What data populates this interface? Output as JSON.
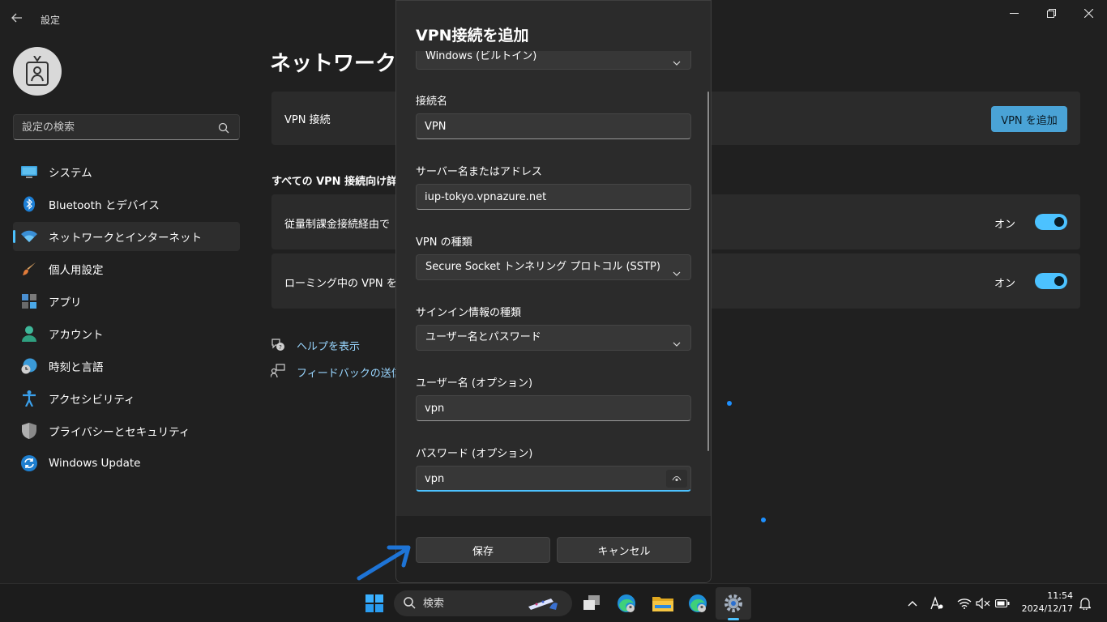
{
  "window": {
    "title": "設定",
    "controls": {
      "minimize": "minimize-icon",
      "maximize": "restore-icon",
      "close": "close-icon"
    }
  },
  "sidebar": {
    "search_placeholder": "設定の検索",
    "items": [
      {
        "label": "システム",
        "icon": "monitor-icon"
      },
      {
        "label": "Bluetooth とデバイス",
        "icon": "bluetooth-icon"
      },
      {
        "label": "ネットワークとインターネット",
        "icon": "wifi-icon",
        "active": true
      },
      {
        "label": "個人用設定",
        "icon": "brush-icon"
      },
      {
        "label": "アプリ",
        "icon": "apps-icon"
      },
      {
        "label": "アカウント",
        "icon": "person-icon"
      },
      {
        "label": "時刻と言語",
        "icon": "globe-clock-icon"
      },
      {
        "label": "アクセシビリティ",
        "icon": "accessibility-icon"
      },
      {
        "label": "プライバシーとセキュリティ",
        "icon": "shield-icon"
      },
      {
        "label": "Windows Update",
        "icon": "update-icon"
      }
    ]
  },
  "main": {
    "title": "ネットワークとイ",
    "vpn_card": {
      "label": "VPN 接続",
      "add_button": "VPN を追加"
    },
    "section_heading": "すべての VPN 接続向け詳細",
    "toggles": [
      {
        "label": "従量制課金接続経由で",
        "state_label": "オン",
        "on": true
      },
      {
        "label": "ローミング中の VPN を許可",
        "state_label": "オン",
        "on": true
      }
    ],
    "links": [
      {
        "label": "ヘルプを表示",
        "icon": "help-icon"
      },
      {
        "label": "フィードバックの送信",
        "icon": "feedback-icon"
      }
    ]
  },
  "dialog": {
    "title": "VPN接続を追加",
    "provider_value": "Windows (ビルトイン)",
    "connection_name_label": "接続名",
    "connection_name_value": "VPN",
    "server_label": "サーバー名またはアドレス",
    "server_value": "iup-tokyo.vpnazure.net",
    "vpn_type_label": "VPN の種類",
    "vpn_type_value": "Secure Socket トンネリング プロトコル (SSTP)",
    "signin_type_label": "サインイン情報の種類",
    "signin_type_value": "ユーザー名とパスワード",
    "username_label": "ユーザー名 (オプション)",
    "username_value": "vpn",
    "password_label": "パスワード (オプション)",
    "password_value": "vpn",
    "save_button": "保存",
    "cancel_button": "キャンセル"
  },
  "taskbar": {
    "search_placeholder": "検索",
    "time": "11:54",
    "date": "2024/12/17"
  },
  "colors": {
    "accent": "#4cc2ff",
    "background": "#202020",
    "card": "#2b2b2b",
    "link": "#99d6ff",
    "arrow": "#1e74d6"
  }
}
